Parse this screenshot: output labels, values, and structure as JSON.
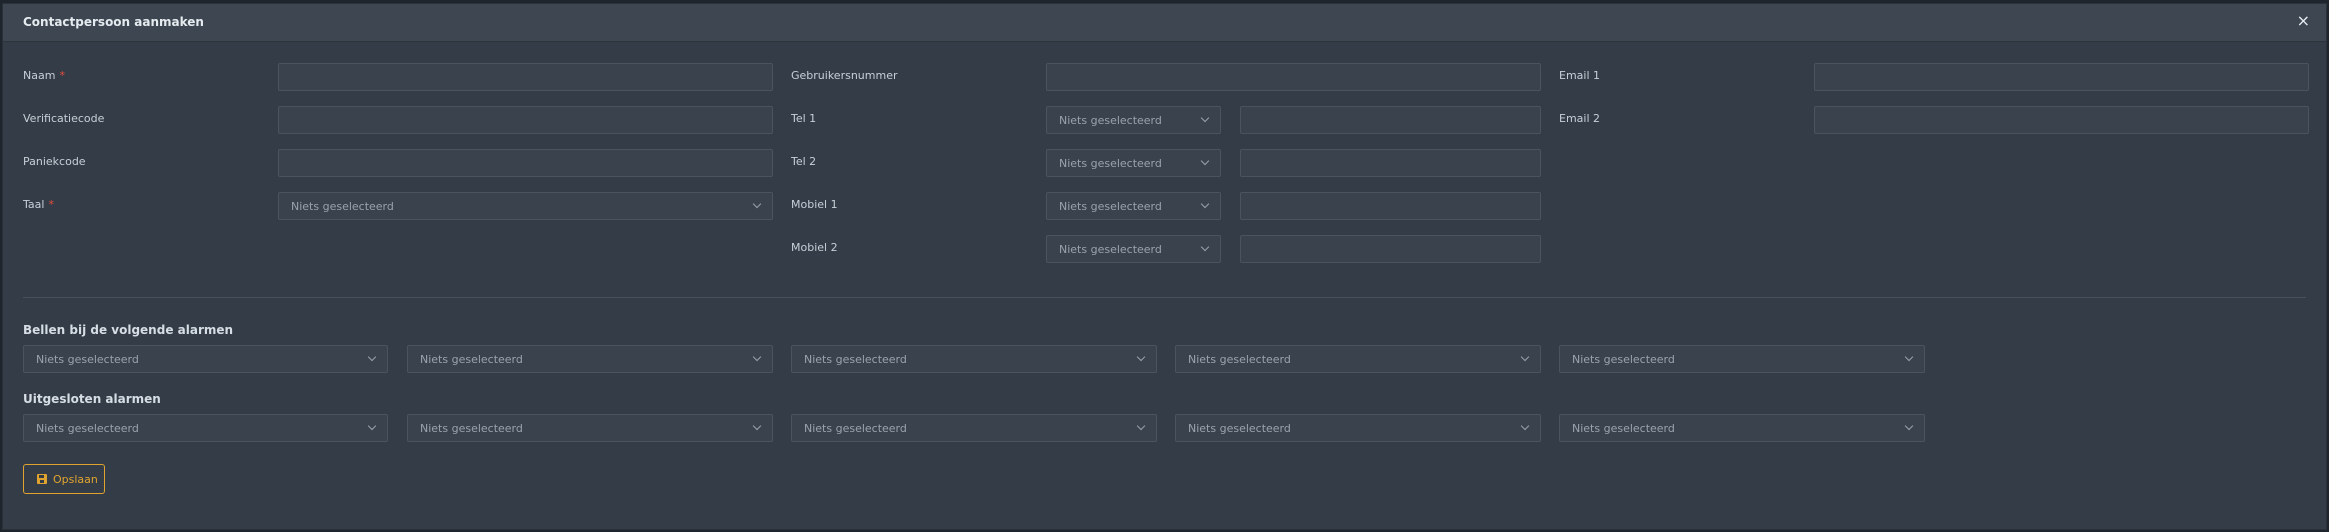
{
  "modal": {
    "title": "Contactpersoon aanmaken",
    "close_label": "×"
  },
  "form": {
    "required_mark": "*",
    "placeholder_select": "Niets geselecteerd",
    "col1": {
      "naam_label": "Naam",
      "verificatiecode_label": "Verificatiecode",
      "paniekcode_label": "Paniekcode",
      "taal_label": "Taal",
      "naam_value": "",
      "verificatiecode_value": "",
      "paniekcode_value": "",
      "taal_value": "Niets geselecteerd"
    },
    "col2": {
      "gebruikersnummer_label": "Gebruikersnummer",
      "gebruikersnummer_value": "",
      "phones": [
        {
          "label": "Tel 1",
          "type": "Niets geselecteerd",
          "value": ""
        },
        {
          "label": "Tel 2",
          "type": "Niets geselecteerd",
          "value": ""
        },
        {
          "label": "Mobiel 1",
          "type": "Niets geselecteerd",
          "value": ""
        },
        {
          "label": "Mobiel 2",
          "type": "Niets geselecteerd",
          "value": ""
        }
      ]
    },
    "col3": {
      "email1_label": "Email 1",
      "email2_label": "Email 2",
      "email1_value": "",
      "email2_value": ""
    }
  },
  "alarms": {
    "call_title": "Bellen bij de volgende alarmen",
    "call_selects": [
      "Niets geselecteerd",
      "Niets geselecteerd",
      "Niets geselecteerd",
      "Niets geselecteerd",
      "Niets geselecteerd"
    ],
    "excluded_title": "Uitgesloten alarmen",
    "excluded_selects": [
      "Niets geselecteerd",
      "Niets geselecteerd",
      "Niets geselecteerd",
      "Niets geselecteerd",
      "Niets geselecteerd"
    ]
  },
  "actions": {
    "save_label": "Opslaan"
  },
  "colors": {
    "accent": "#e0a32e",
    "required": "#e74c3c",
    "panel": "#343d47"
  }
}
